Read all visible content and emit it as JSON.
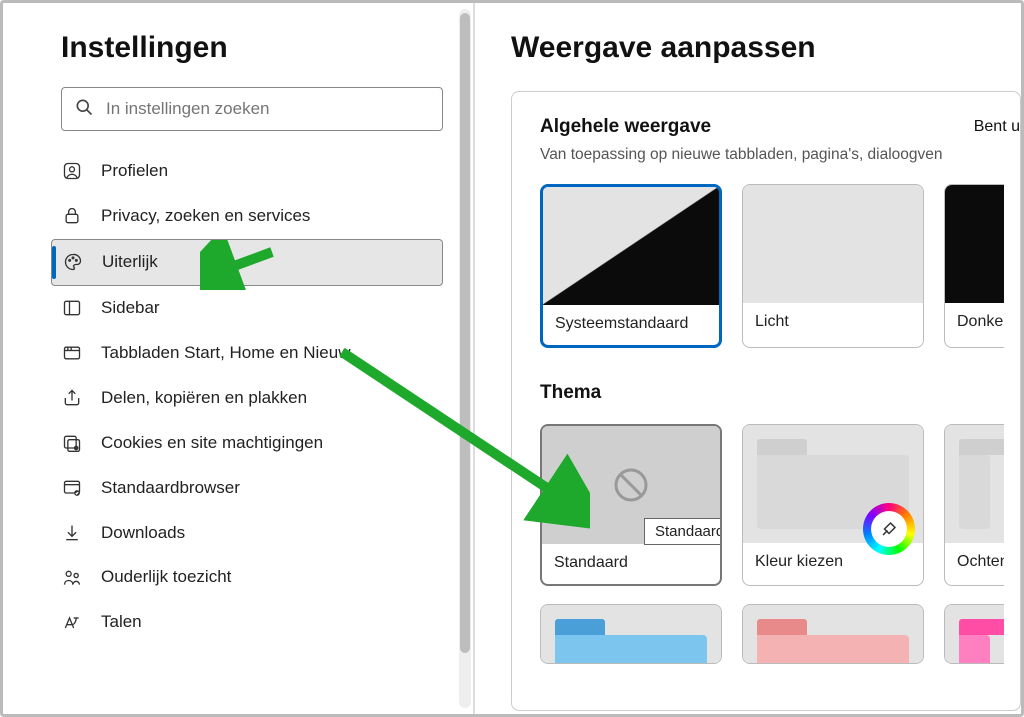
{
  "sidebar": {
    "title": "Instellingen",
    "search_placeholder": "In instellingen zoeken",
    "items": [
      {
        "label": "Profielen"
      },
      {
        "label": "Privacy, zoeken en services"
      },
      {
        "label": "Uiterlijk"
      },
      {
        "label": "Sidebar"
      },
      {
        "label": "Tabbladen Start, Home en Nieuw"
      },
      {
        "label": "Delen, kopiëren en plakken"
      },
      {
        "label": "Cookies en site machtigingen"
      },
      {
        "label": "Standaardbrowser"
      },
      {
        "label": "Downloads"
      },
      {
        "label": "Ouderlijk toezicht"
      },
      {
        "label": "Talen"
      }
    ]
  },
  "main": {
    "title": "Weergave aanpassen",
    "appearance_section": {
      "title": "Algehele weergave",
      "subtitle": "Van toepassing op nieuwe tabbladen, pagina's, dialoogven",
      "right_link": "Bent u",
      "cards": [
        {
          "label": "Systeemstandaard"
        },
        {
          "label": "Licht"
        },
        {
          "label": "Donker"
        }
      ]
    },
    "theme_section": {
      "title": "Thema",
      "cards": [
        {
          "label": "Standaard",
          "tooltip": "Standaard"
        },
        {
          "label": "Kleur kiezen"
        },
        {
          "label": "Ochtend"
        }
      ]
    }
  }
}
